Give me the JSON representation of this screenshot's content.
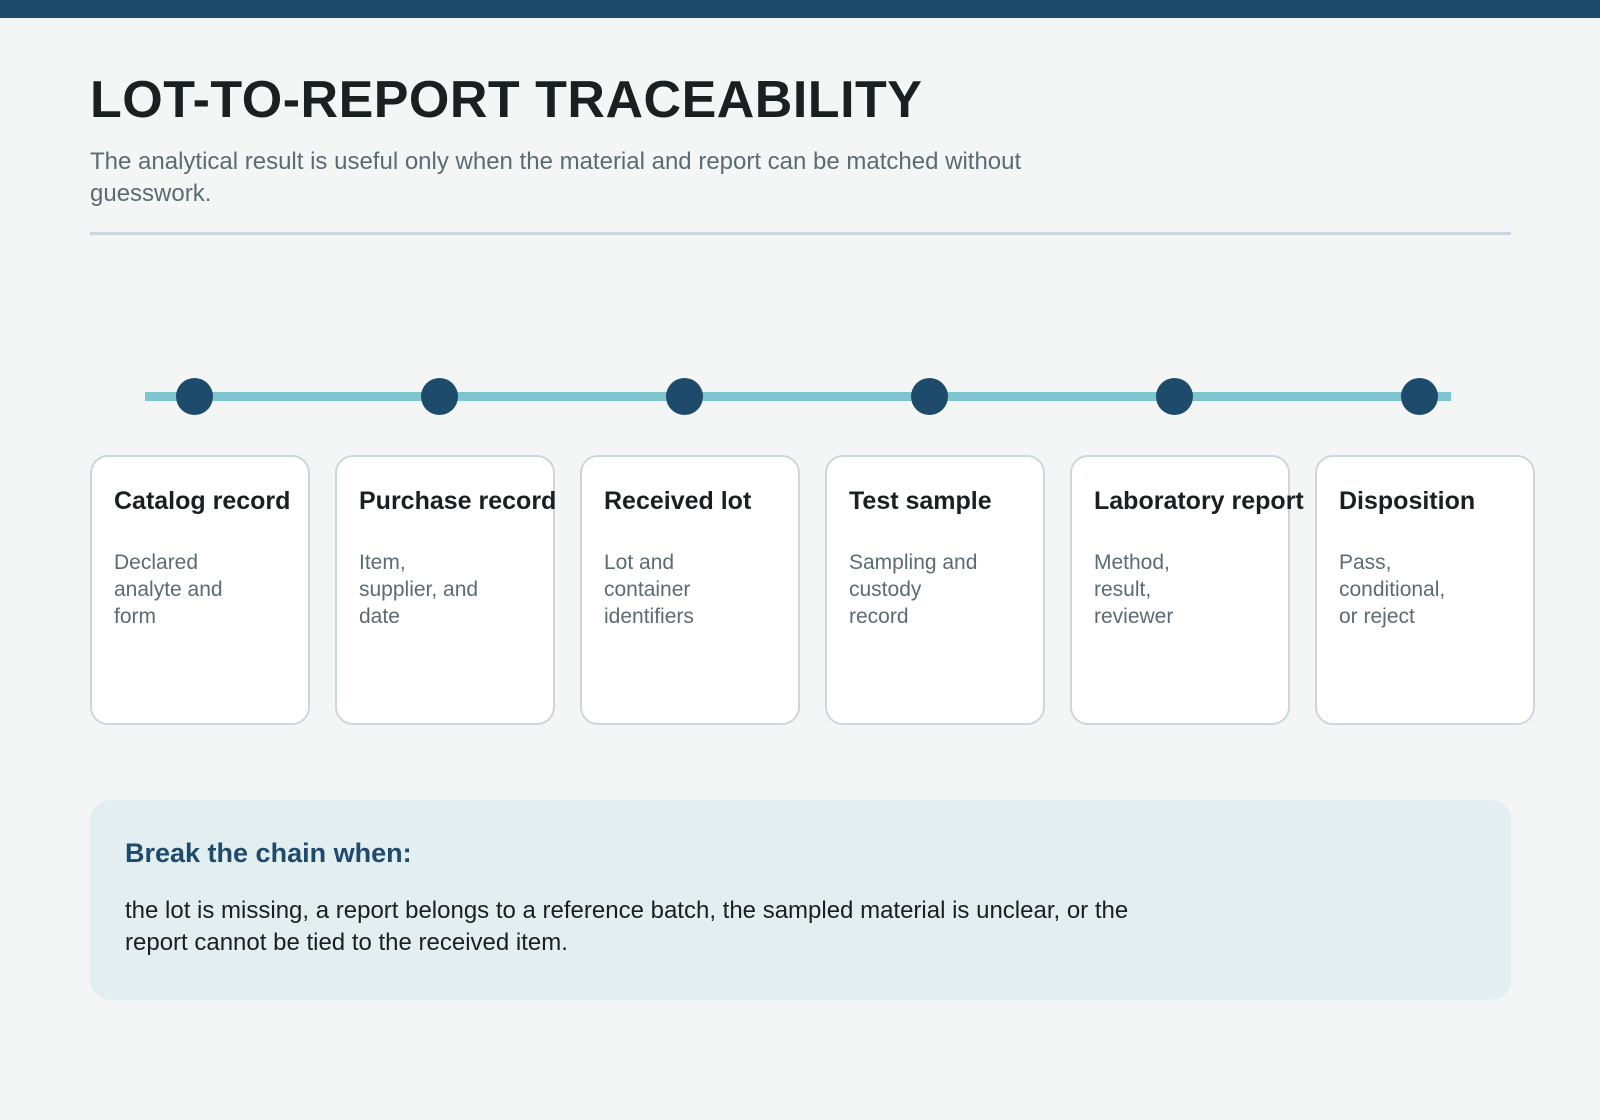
{
  "header": {
    "title": "LOT-TO-REPORT TRACEABILITY",
    "subtitle": "The analytical result is useful only when the material and report can be matched without guesswork."
  },
  "steps": [
    {
      "title": "Catalog record",
      "description": "Declared analyte and form"
    },
    {
      "title": "Purchase record",
      "description": "Item, supplier, and date"
    },
    {
      "title": "Received lot",
      "description": "Lot and container identifiers"
    },
    {
      "title": "Test sample",
      "description": "Sampling and custody record"
    },
    {
      "title": "Laboratory report",
      "description": "Method, result, reviewer"
    },
    {
      "title": "Disposition",
      "description": "Pass, conditional, or reject"
    }
  ],
  "note": {
    "heading": "Break the chain when:",
    "body": "the lot is missing, a report belongs to a reference batch, the sampled material is unclear, or the report cannot be tied to the received item."
  },
  "colors": {
    "accent": "#1e4a6c",
    "track": "#7ec5d0",
    "card_border": "#cbd7da",
    "background": "#f4f6f6",
    "note_background": "#e3eef0"
  }
}
